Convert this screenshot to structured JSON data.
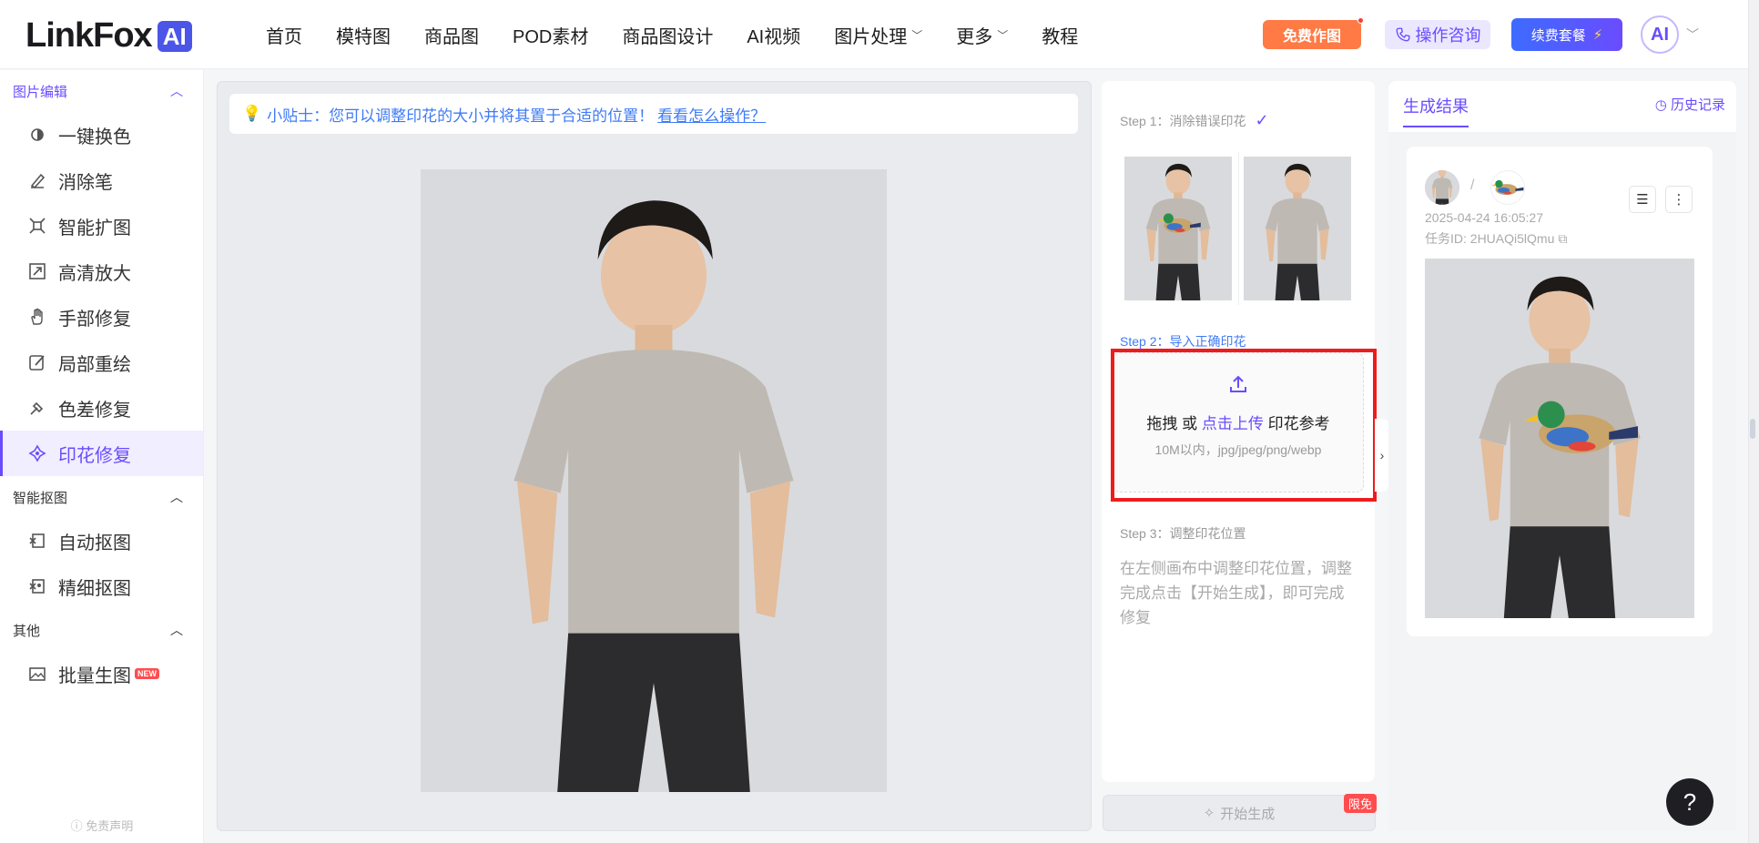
{
  "brand": {
    "name": "LinkFox",
    "badge": "AI"
  },
  "nav": [
    {
      "label": "首页"
    },
    {
      "label": "模特图"
    },
    {
      "label": "商品图"
    },
    {
      "label": "POD素材"
    },
    {
      "label": "商品图设计"
    },
    {
      "label": "AI视频"
    },
    {
      "label": "图片处理",
      "dropdown": true
    },
    {
      "label": "更多",
      "dropdown": true
    },
    {
      "label": "教程"
    }
  ],
  "header": {
    "free_btn": "免费作图",
    "consult_btn": "操作咨询",
    "renew_btn": "续费套餐",
    "avatar_text": "AI"
  },
  "sidebar": {
    "sections": [
      {
        "title": "图片编辑",
        "active": true,
        "items": [
          {
            "label": "一键换色",
            "icon": "color-swap-icon"
          },
          {
            "label": "消除笔",
            "icon": "eraser-pen-icon"
          },
          {
            "label": "智能扩图",
            "icon": "expand-icon"
          },
          {
            "label": "高清放大",
            "icon": "upscale-icon"
          },
          {
            "label": "手部修复",
            "icon": "hand-icon"
          },
          {
            "label": "局部重绘",
            "icon": "repaint-icon"
          },
          {
            "label": "色差修复",
            "icon": "color-fix-icon"
          },
          {
            "label": "印花修复",
            "icon": "print-fix-icon",
            "active": true
          }
        ]
      },
      {
        "title": "智能抠图",
        "items": [
          {
            "label": "自动抠图",
            "icon": "auto-cutout-icon"
          },
          {
            "label": "精细抠图",
            "icon": "fine-cutout-icon"
          }
        ]
      },
      {
        "title": "其他",
        "items": [
          {
            "label": "批量生图",
            "icon": "batch-image-icon",
            "badge": "NEW"
          }
        ]
      }
    ],
    "disclaimer": "免责声明"
  },
  "canvas": {
    "tip_text": "小贴士：您可以调整印花的大小并将其置于合适的位置！",
    "tip_link": "看看怎么操作？"
  },
  "steps": {
    "step1": "Step 1：消除错误印花",
    "step2": "Step 2：导入正确印花",
    "upload_pre": "拖拽 或 ",
    "upload_link": "点击上传",
    "upload_post": " 印花参考",
    "upload_sub": "10M以内，jpg/jpeg/png/webp",
    "step3": "Step 3：调整印花位置",
    "step3_desc": "在左侧画布中调整印花位置，调整完成点击【开始生成】，即可完成修复",
    "generate": "开始生成",
    "limit_badge": "限免"
  },
  "result": {
    "tab": "生成结果",
    "history": "历史记录",
    "timestamp": "2025-04-24 16:05:27",
    "task_id": "任务ID: 2HUAQi5lQmu"
  },
  "colors": {
    "accent": "#6a4cff",
    "link": "#3f7bf6",
    "free": "#ff7a45",
    "highlight": "#ee1c1c"
  }
}
